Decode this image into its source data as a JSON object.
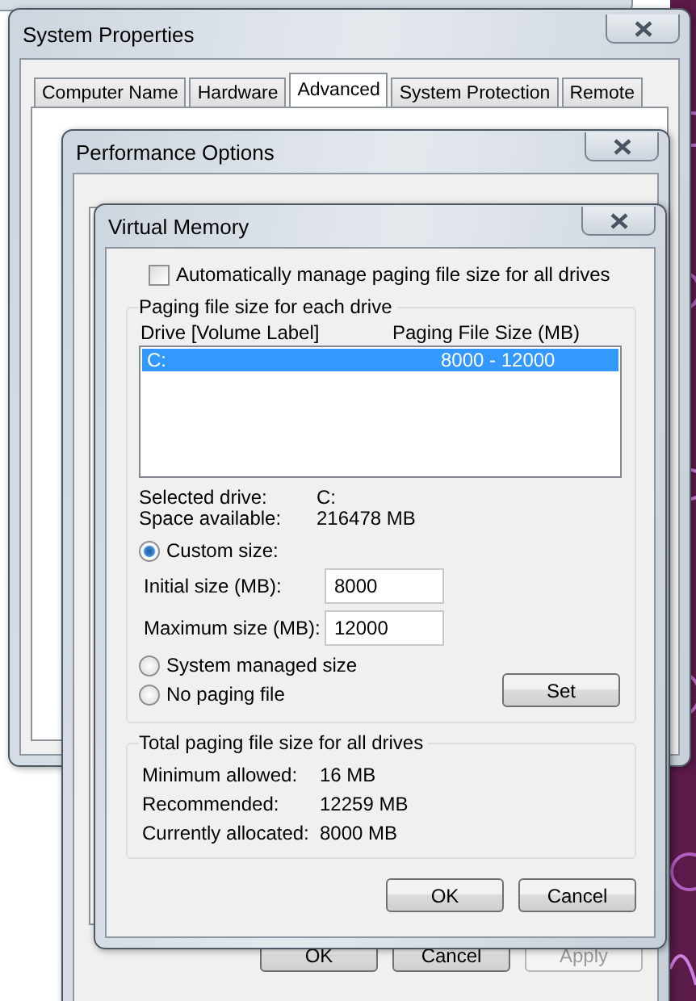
{
  "system_properties": {
    "title": "System Properties",
    "tabs": [
      {
        "label": "Computer Name",
        "selected": false
      },
      {
        "label": "Hardware",
        "selected": false
      },
      {
        "label": "Advanced",
        "selected": true
      },
      {
        "label": "System Protection",
        "selected": false
      },
      {
        "label": "Remote",
        "selected": false
      }
    ]
  },
  "performance_options": {
    "title": "Performance Options",
    "buttons": [
      {
        "label": "OK",
        "disabled": false
      },
      {
        "label": "Cancel",
        "disabled": false
      },
      {
        "label": "Apply",
        "disabled": true
      }
    ]
  },
  "virtual_memory": {
    "title": "Virtual Memory",
    "auto_manage": {
      "label": "Automatically manage paging file size for all drives",
      "checked": false
    },
    "paging_group": {
      "title": "Paging file size for each drive",
      "columns": [
        "Drive  [Volume Label]",
        "Paging File Size (MB)"
      ],
      "rows": [
        {
          "drive": "C:",
          "size": "8000 - 12000",
          "selected": true
        }
      ],
      "details": [
        {
          "label": "Selected drive:",
          "value": "C:"
        },
        {
          "label": "Space available:",
          "value": "216478 MB"
        }
      ],
      "options": [
        {
          "label": "Custom size:",
          "selected": true
        },
        {
          "label": "System managed size",
          "selected": false
        },
        {
          "label": "No paging file",
          "selected": false
        }
      ],
      "size_fields": [
        {
          "label": "Initial size (MB):",
          "value": "8000"
        },
        {
          "label": "Maximum size (MB):",
          "value": "12000"
        }
      ],
      "set_button": "Set"
    },
    "total_group": {
      "title": "Total paging file size for all drives",
      "rows": [
        {
          "label": "Minimum allowed:",
          "value": "16 MB"
        },
        {
          "label": "Recommended:",
          "value": "12259 MB"
        },
        {
          "label": "Currently allocated:",
          "value": "8000 MB"
        }
      ]
    },
    "buttons": [
      "OK",
      "Cancel"
    ]
  }
}
